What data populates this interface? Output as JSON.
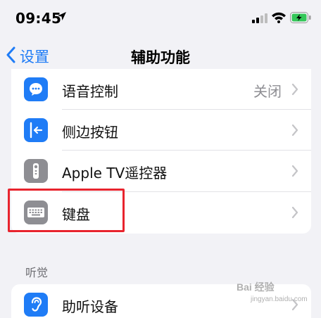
{
  "status_bar": {
    "time": "09:45"
  },
  "nav": {
    "back_label": "设置",
    "title": "辅助功能"
  },
  "rows": [
    {
      "label": "语音控制",
      "value": "关闭",
      "icon": "voice-control-icon"
    },
    {
      "label": "侧边按钮",
      "value": "",
      "icon": "side-button-icon"
    },
    {
      "label": "Apple TV遥控器",
      "value": "",
      "icon": "apple-tv-remote-icon"
    },
    {
      "label": "键盘",
      "value": "",
      "icon": "keyboard-icon"
    }
  ],
  "hearing_section": {
    "header": "听觉",
    "rows": [
      {
        "label": "助听设备",
        "icon": "hearing-devices-icon"
      }
    ]
  },
  "watermark": {
    "text": "Bai 经验",
    "sub": "jingyan.baidu.com"
  },
  "colors": {
    "accent": "#1f7cf6",
    "highlight": "#e8242e",
    "icon_blue": "#1f7cf6",
    "icon_gray": "#8e8e93",
    "battery_green": "#34c759"
  }
}
